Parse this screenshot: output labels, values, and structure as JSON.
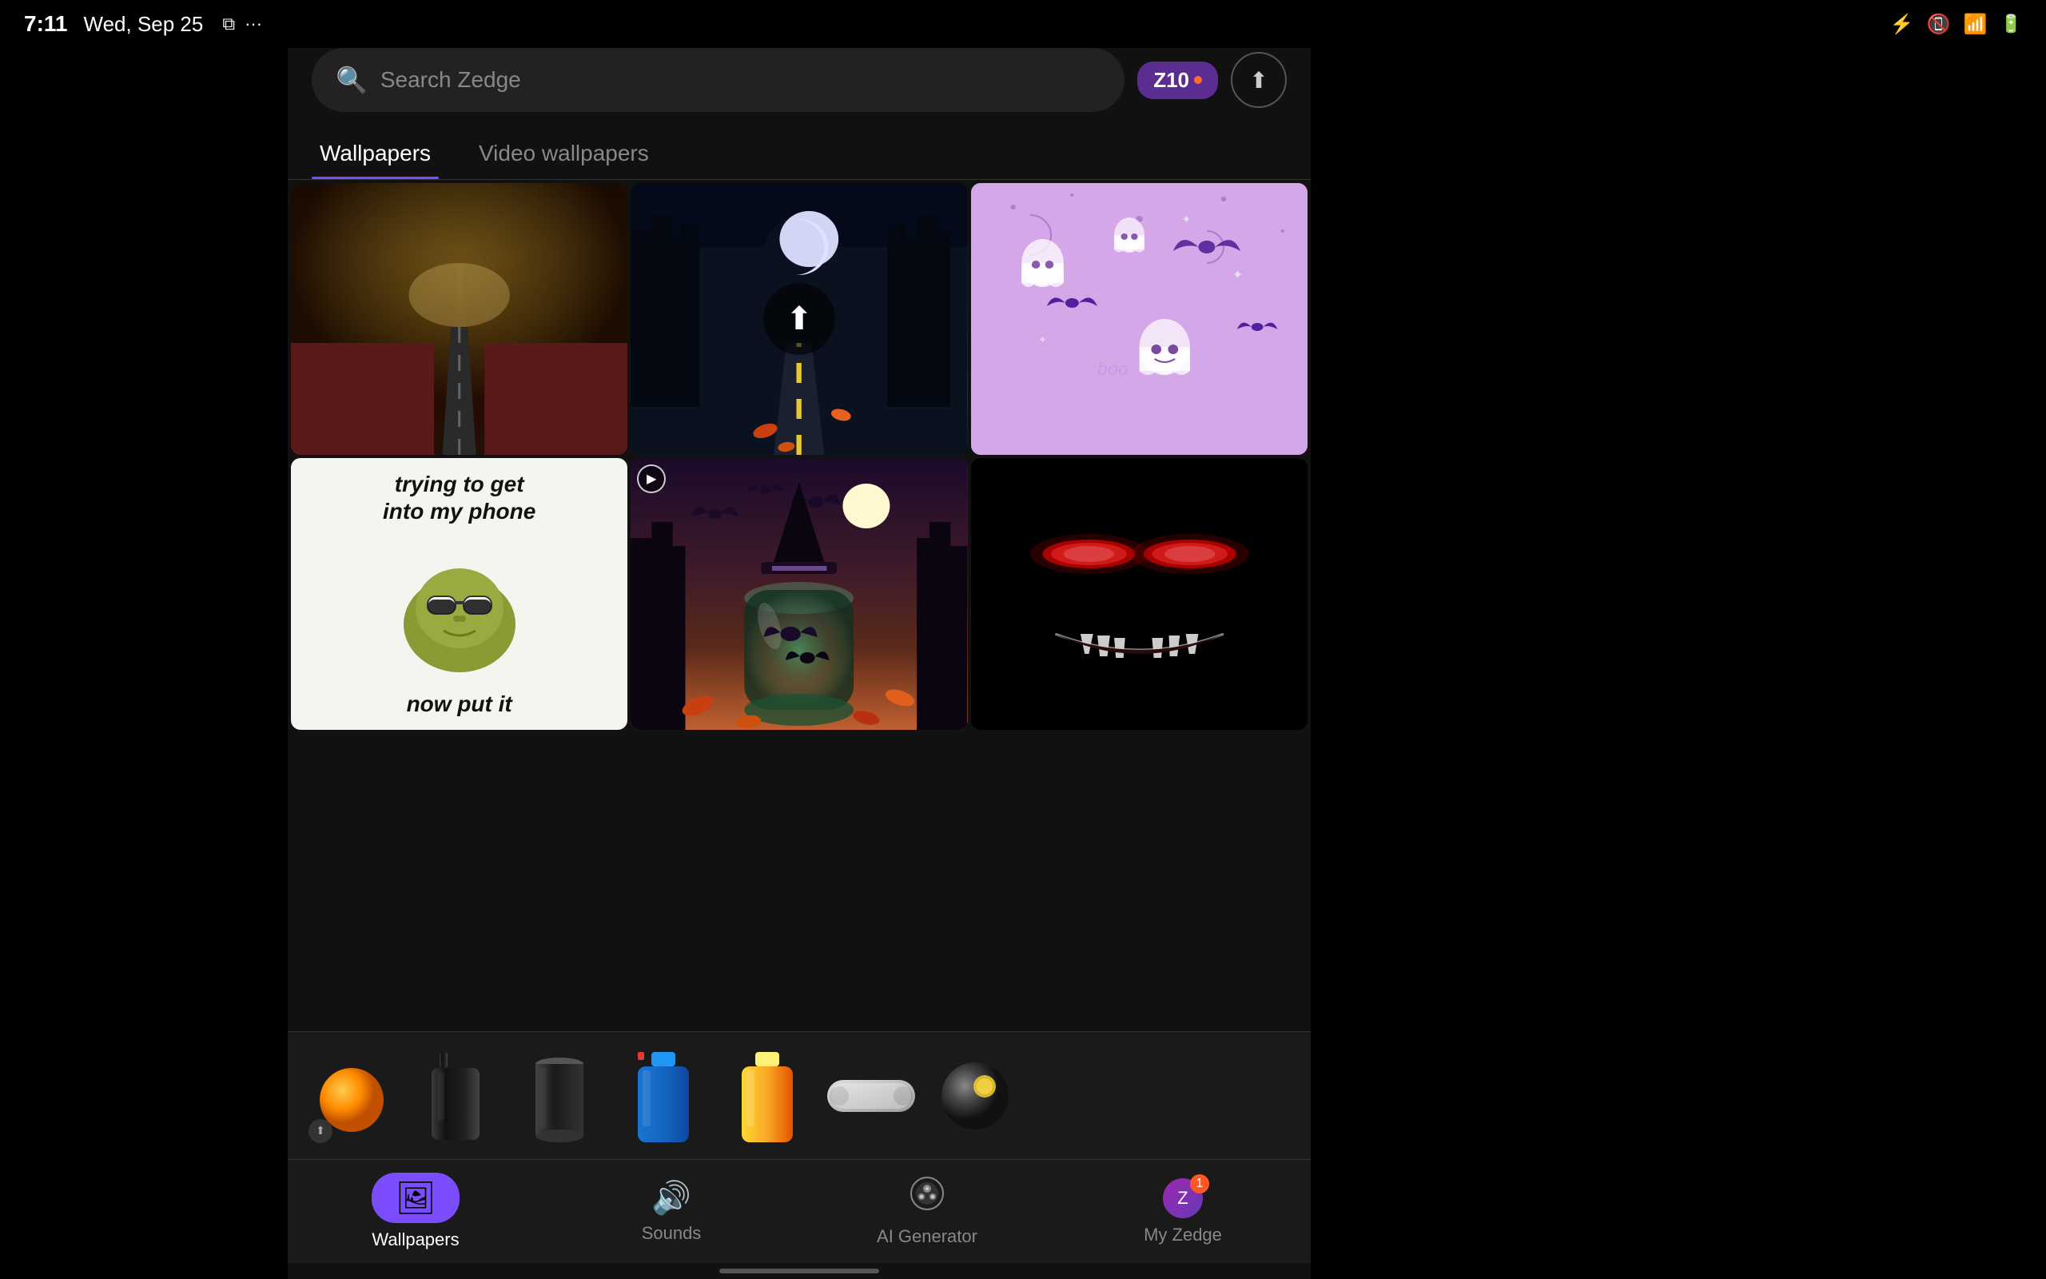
{
  "statusBar": {
    "time": "7:11",
    "date": "Wed, Sep 25",
    "icons": [
      "copy-icon",
      "more-icon"
    ],
    "rightIcons": [
      "bluetooth-icon",
      "no-signal-icon",
      "wifi-icon",
      "battery-icon"
    ]
  },
  "topMenu": {
    "dotsLabel": "···"
  },
  "searchBar": {
    "placeholder": "Search Zedge",
    "zbadge": "Z10",
    "uploadIcon": "↑"
  },
  "tabs": [
    {
      "id": "wallpapers",
      "label": "Wallpapers",
      "active": true
    },
    {
      "id": "video-wallpapers",
      "label": "Video wallpapers",
      "active": false
    }
  ],
  "wallpapers": [
    {
      "id": "stormy-road",
      "type": "image",
      "description": "Stormy road with red leaves"
    },
    {
      "id": "moonlit-road",
      "type": "image-with-upload",
      "description": "Moonlit forest road"
    },
    {
      "id": "ghost-pattern",
      "type": "image",
      "description": "Purple ghost and bat pattern"
    },
    {
      "id": "meme",
      "type": "image",
      "topText": "trying to get into my phone",
      "bottomText": "now put it",
      "description": "Kermit meme"
    },
    {
      "id": "halloween-jar",
      "type": "image-with-icon",
      "description": "Halloween bat jar"
    },
    {
      "id": "evil-face",
      "type": "image",
      "description": "Evil glowing eyes face"
    }
  ],
  "productStrip": {
    "items": [
      {
        "id": "orange-ball",
        "type": "sphere-orange"
      },
      {
        "id": "black-bottle",
        "type": "bottle-black"
      },
      {
        "id": "black-cylinder",
        "type": "cylinder-black"
      },
      {
        "id": "blue-bottle",
        "type": "bottle-blue"
      },
      {
        "id": "yellow-bottle",
        "type": "bottle-yellow"
      },
      {
        "id": "white-device",
        "type": "device-white"
      },
      {
        "id": "dark-ball",
        "type": "sphere-dark"
      }
    ]
  },
  "bottomNav": [
    {
      "id": "wallpapers",
      "label": "Wallpapers",
      "icon": "🖼",
      "active": true
    },
    {
      "id": "sounds",
      "label": "Sounds",
      "icon": "🔊",
      "active": false
    },
    {
      "id": "ai-generator",
      "label": "AI Generator",
      "icon": "😊",
      "active": false
    },
    {
      "id": "my-zedge",
      "label": "My Zedge",
      "icon": "👤",
      "active": false,
      "badge": "1"
    }
  ],
  "colors": {
    "accent": "#7c4dff",
    "background": "#111111",
    "tabActive": "#7c4dff",
    "navBackground": "#1a1a1a"
  }
}
